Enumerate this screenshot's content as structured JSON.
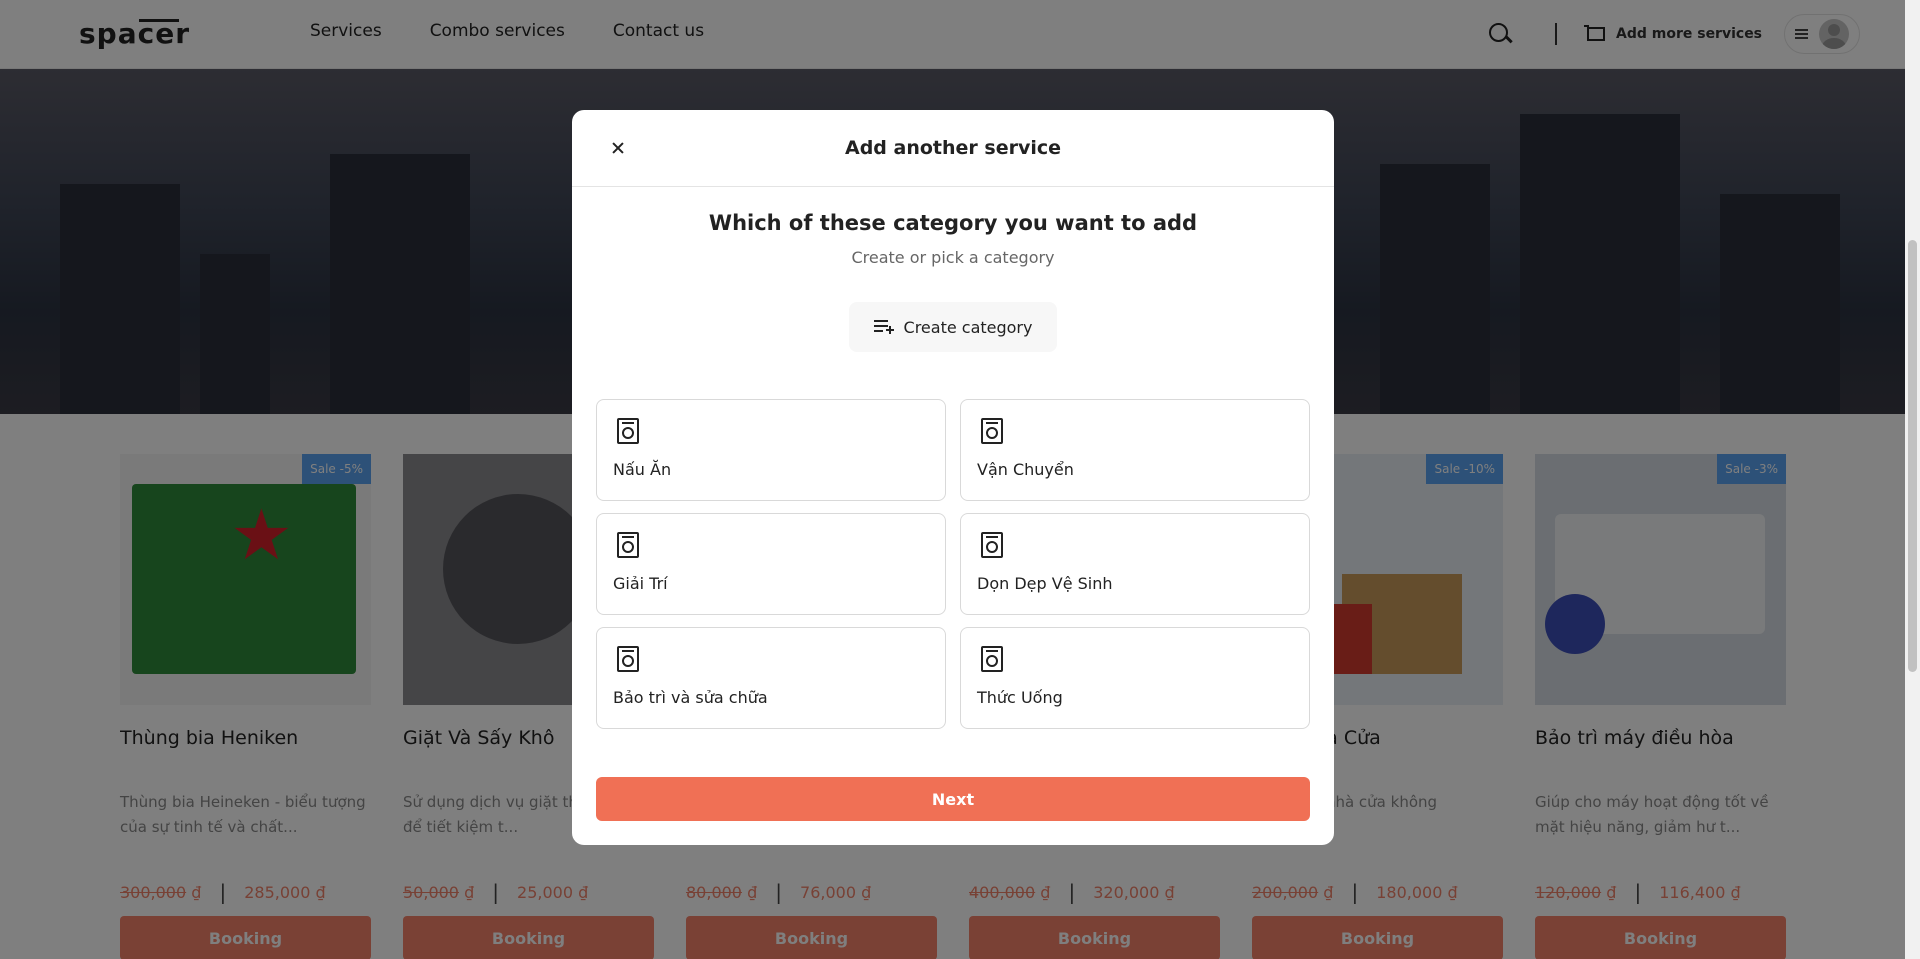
{
  "header": {
    "logo": "spacer",
    "nav": [
      "Services",
      "Combo services",
      "Contact us"
    ],
    "add_more": "Add more services"
  },
  "products": [
    {
      "title": "Thùng bia Heniken",
      "desc": "Thùng bia Heineken - biểu tượng của sự tinh tế và chất...",
      "old_price": "300,000",
      "new_price": "285,000",
      "sale": "Sale -5%"
    },
    {
      "title": "Giặt Và Sấy Khô",
      "desc": "Sử dụng dịch vụ giặt thu... khô để tiết kiệm t...",
      "old_price": "50,000",
      "new_price": "25,000",
      "sale": ""
    },
    {
      "title": "",
      "desc": "",
      "old_price": "80,000",
      "new_price": "76,000",
      "sale": ""
    },
    {
      "title": "",
      "desc": "",
      "old_price": "400,000",
      "new_price": "320,000",
      "sale": ""
    },
    {
      "title": "...ển Nhà Cửa",
      "desc": "...chuyển nhà cửa không ...chuyển...",
      "old_price": "200,000",
      "new_price": "180,000",
      "sale": "Sale -10%"
    },
    {
      "title": "Bảo trì máy điều hòa",
      "desc": "Giúp cho máy hoạt động tốt về mặt hiệu năng, giảm hư t...",
      "old_price": "120,000",
      "new_price": "116,400",
      "sale": "Sale -3%"
    }
  ],
  "currency": "₫",
  "booking_label": "Booking",
  "modal": {
    "title": "Add another service",
    "question": "Which of these category you want to add",
    "subtitle": "Create or pick a category",
    "create_label": "Create category",
    "categories": [
      "Nấu Ăn",
      "Vận Chuyển",
      "Giải Trí",
      "Dọn Dẹp Vệ Sinh",
      "Bảo trì và sửa chữa",
      "Thức Uống"
    ],
    "next_label": "Next"
  }
}
